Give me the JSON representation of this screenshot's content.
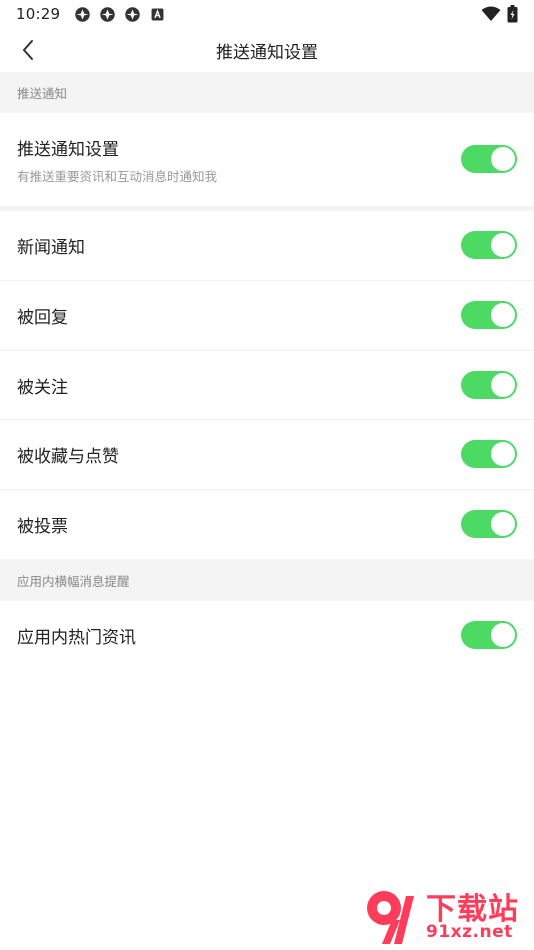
{
  "status_bar": {
    "time": "10:29",
    "left_icons": [
      "app-notification-icon",
      "app-notification-icon",
      "app-notification-icon",
      "a-badge-icon"
    ],
    "right_icons": [
      "wifi-icon",
      "battery-icon"
    ]
  },
  "header": {
    "title": "推送通知设置",
    "back_icon": "chevron-left-icon"
  },
  "sections": {
    "push": {
      "title": "推送通知",
      "main_row": {
        "label": "推送通知设置",
        "description": "有推送重要资讯和互动消息时通知我",
        "enabled": true
      }
    },
    "items": [
      {
        "label": "新闻通知",
        "enabled": true
      },
      {
        "label": "被回复",
        "enabled": true
      },
      {
        "label": "被关注",
        "enabled": true
      },
      {
        "label": "被收藏与点赞",
        "enabled": true
      },
      {
        "label": "被投票",
        "enabled": true
      }
    ],
    "banner": {
      "title": "应用内横幅消息提醒",
      "items": [
        {
          "label": "应用内热门资讯",
          "enabled": true
        }
      ]
    }
  },
  "watermark": {
    "title": "下载站",
    "url": "91xz.net"
  },
  "colors": {
    "toggle_on": "#4cd964",
    "section_bg": "#f4f4f4",
    "watermark": "#ff3d5a"
  }
}
